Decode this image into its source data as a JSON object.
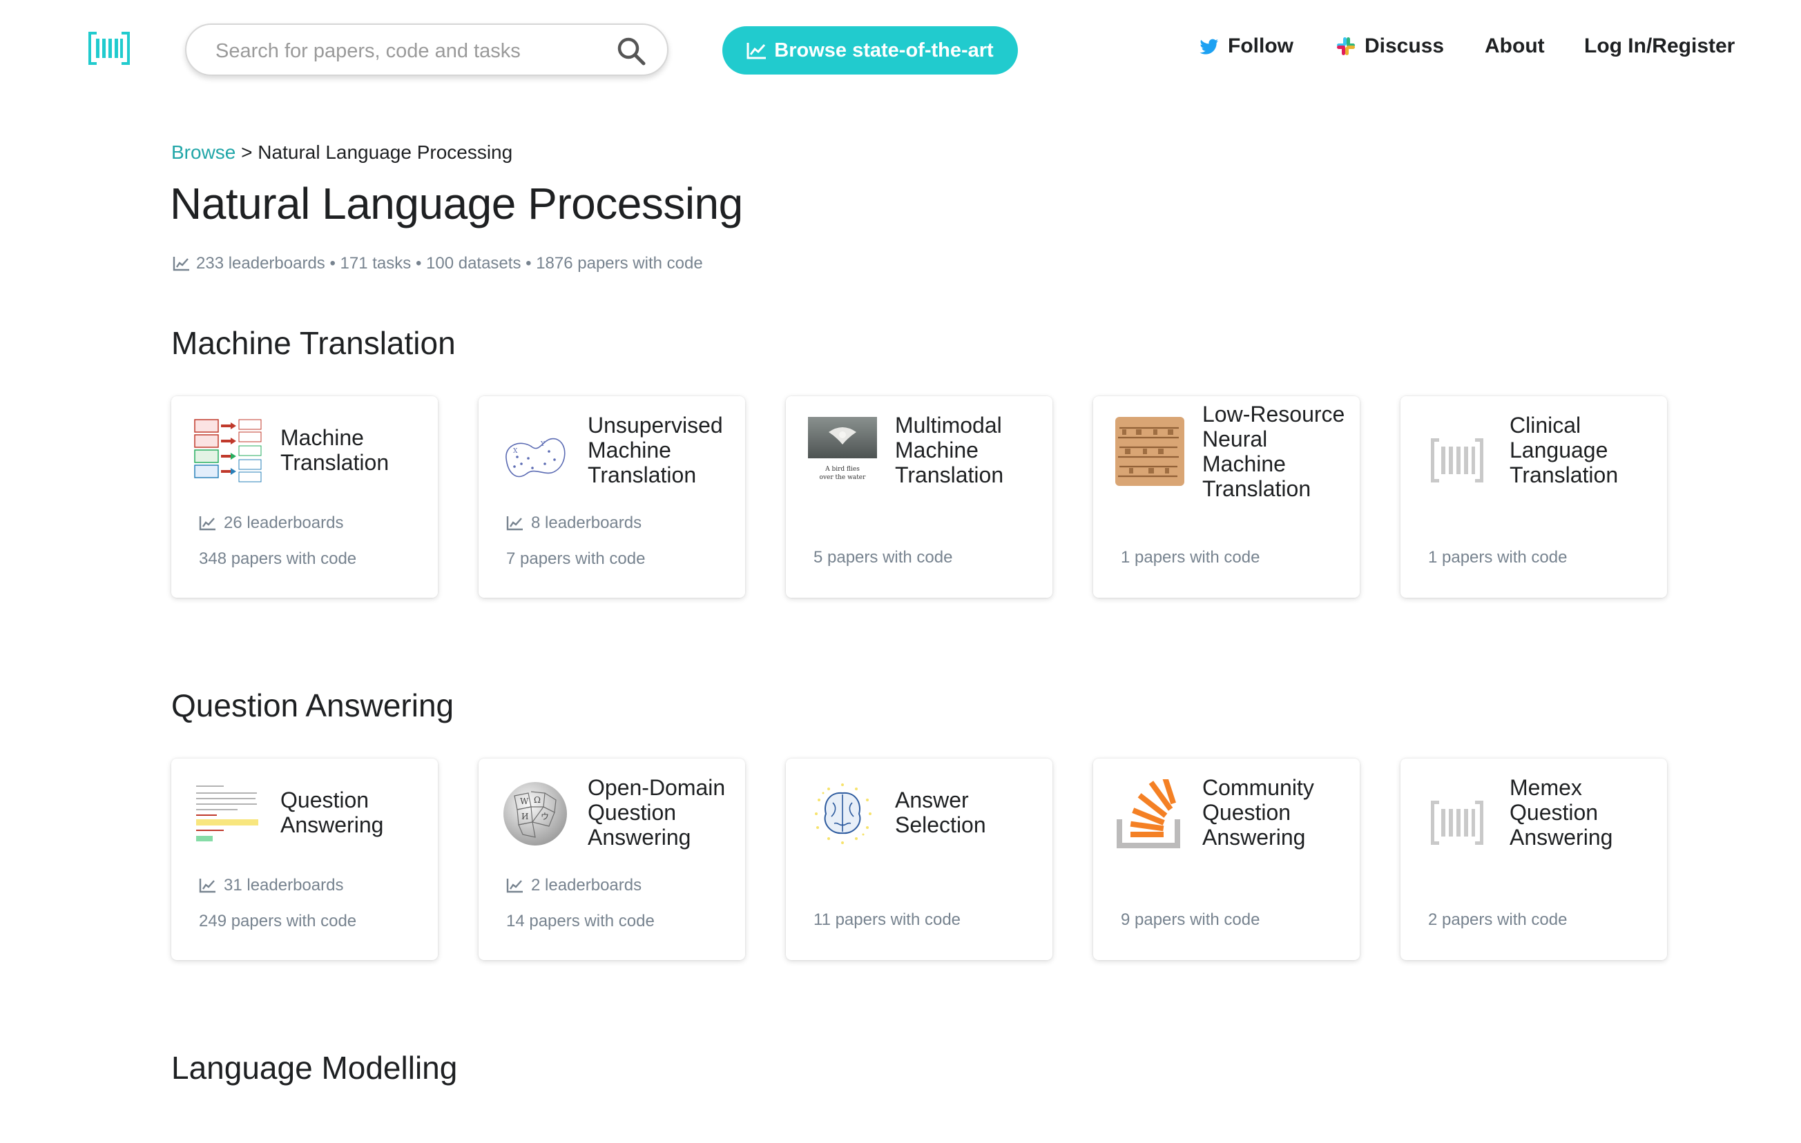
{
  "header": {
    "search_placeholder": "Search for papers, code and tasks",
    "browse_button": "Browse state-of-the-art",
    "nav": [
      "Follow",
      "Discuss",
      "About",
      "Log In/Register"
    ]
  },
  "breadcrumb": {
    "link": "Browse",
    "separator": ">",
    "current": "Natural Language Processing"
  },
  "page_title": "Natural Language Processing",
  "stats": "233 leaderboards • 171 tasks • 100 datasets • 1876 papers with code",
  "colors": {
    "accent": "#21cbce",
    "link": "#21a6a8",
    "muted": "#77838f",
    "text": "#1e2022"
  },
  "sections": [
    {
      "title": "Machine Translation",
      "cards": [
        {
          "title": "Machine Translation",
          "leaderboards": "26 leaderboards",
          "papers": "348 papers with code",
          "icon": "diagram-thumbnail"
        },
        {
          "title": "Unsupervised Machine Translation",
          "leaderboards": "8 leaderboards",
          "papers": "7 papers with code",
          "icon": "embedding-space-thumbnail"
        },
        {
          "title": "Multimodal Machine Translation",
          "leaderboards": "",
          "papers": "5 papers with code",
          "icon": "bird-photo-thumbnail",
          "caption": "A bird flies over the water"
        },
        {
          "title": "Low-Resource Neural Machine Translation",
          "leaderboards": "",
          "papers": "1 papers with code",
          "icon": "manuscript-thumbnail"
        },
        {
          "title": "Clinical Language Translation",
          "leaderboards": "",
          "papers": "1 papers with code",
          "icon": "pwc-logo-placeholder"
        }
      ]
    },
    {
      "title": "Question Answering",
      "cards": [
        {
          "title": "Question Answering",
          "leaderboards": "31 leaderboards",
          "papers": "249 papers with code",
          "icon": "passage-thumbnail"
        },
        {
          "title": "Open-Domain Question Answering",
          "leaderboards": "2 leaderboards",
          "papers": "14 papers with code",
          "icon": "wikipedia-globe"
        },
        {
          "title": "Answer Selection",
          "leaderboards": "",
          "papers": "11 papers with code",
          "icon": "brain-thumbnail"
        },
        {
          "title": "Community Question Answering",
          "leaderboards": "",
          "papers": "9 papers with code",
          "icon": "stack-overflow-logo"
        },
        {
          "title": "Memex Question Answering",
          "leaderboards": "",
          "papers": "2 papers with code",
          "icon": "pwc-logo-placeholder"
        }
      ]
    },
    {
      "title": "Language Modelling",
      "cards": []
    }
  ]
}
